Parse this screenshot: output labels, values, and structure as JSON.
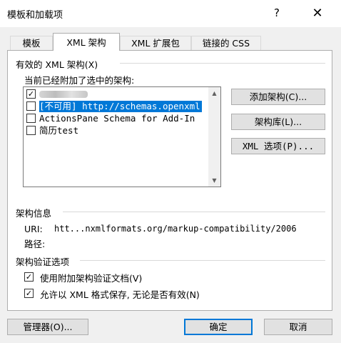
{
  "window": {
    "title": "模板和加载项",
    "help": "?",
    "close": "✕"
  },
  "tabs": [
    {
      "label": "模板"
    },
    {
      "label": "XML 架构"
    },
    {
      "label": "XML 扩展包"
    },
    {
      "label": "链接的 CSS"
    }
  ],
  "schemas": {
    "section_title": "有效的 XML 架构(X)",
    "list_label": "当前已经附加了选中的架构:",
    "items": [
      {
        "label": "",
        "checked": true
      },
      {
        "label": "[不可用] http://schemas.openxml",
        "checked": false,
        "selected": true
      },
      {
        "label": "ActionsPane Schema for Add-In",
        "checked": false
      },
      {
        "label": "简历test",
        "checked": false
      }
    ],
    "scroll_up": "▲",
    "scroll_down": "▼",
    "add_button": "添加架构(C)...",
    "library_button": "架构库(L)...",
    "options_button": "XML 选项(P)..."
  },
  "info": {
    "section_title": "架构信息",
    "uri_label": "URI:",
    "uri_value": "htt...nxmlformats.org/markup-compatibility/2006",
    "path_label": "路径:"
  },
  "validation": {
    "section_title": "架构验证选项",
    "opt1": {
      "label": "使用附加架构验证文档(V)",
      "checked": true
    },
    "opt2": {
      "label": "允许以 XML 格式保存, 无论是否有效(N)",
      "checked": true
    }
  },
  "footer": {
    "manager": "管理器(O)...",
    "ok": "确定",
    "cancel": "取消"
  },
  "check_mark": "✓"
}
